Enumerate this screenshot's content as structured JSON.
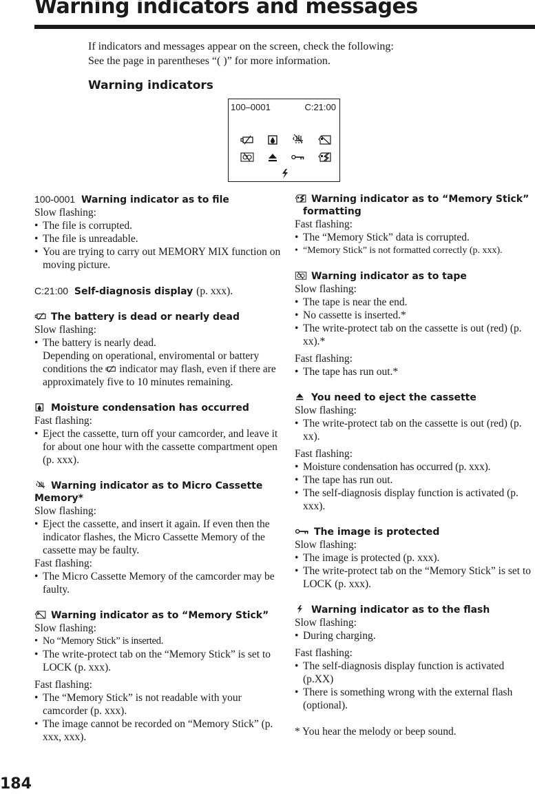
{
  "page": {
    "title": "Warning indicators and messages",
    "intro_line1": "If indicators and messages appear on the screen, check the following:",
    "intro_line2": "See the page in parentheses “(    )” for more information.",
    "subheading": "Warning indicators",
    "page_number": "184"
  },
  "screen": {
    "file_number": "100–0001",
    "self_diagnosis_code": "C:21:00",
    "icons": [
      "battery-dead-icon",
      "moisture-icon",
      "cassette-memory-icon",
      "memory-stick-icon",
      "tape-warning-icon",
      "eject-icon",
      "protect-key-icon",
      "memory-stick-format-icon",
      "flash-icon"
    ]
  },
  "left": {
    "file": {
      "code": "100-0001",
      "heading": "Warning indicator as to file",
      "label1": "Slow flashing:",
      "items1": [
        "The file is corrupted.",
        "The file is unreadable.",
        "You are trying to carry out MEMORY MIX function on moving picture."
      ]
    },
    "diag": {
      "code": "C:21:00",
      "heading": "Self-diagnosis display",
      "ref": "(p. xxx)."
    },
    "battery": {
      "heading": "The battery is dead or nearly dead",
      "label1": "Slow flashing:",
      "item1": "The battery is nearly dead.",
      "cont1": "Depending on operational, enviromental or battery conditions the",
      "cont2": "indicator may flash, even if there are approximately five to 10 minutes remaining."
    },
    "moisture": {
      "heading": "Moisture condensation has occurred",
      "label1": "Fast flashing:",
      "items1": [
        "Eject the cassette, turn off your camcorder, and leave it for about one hour with the cassette compartment open (p. xxx)."
      ]
    },
    "cassette_memory": {
      "heading": "Warning indicator as to Micro Cassette Memory*",
      "label1": "Slow flashing:",
      "items1": [
        "Eject the cassette, and insert it again. If even then the indicator flashes, the Micro Cassette Memory of the cassette may be faulty."
      ],
      "label2": "Fast flashing:",
      "items2": [
        "The Micro Cassette Memory of the camcorder may be faulty."
      ]
    },
    "memory_stick": {
      "heading": "Warning indicator as to “Memory Stick”",
      "label1": "Slow flashing:",
      "items1": [
        "No “Memory Stick” is inserted.",
        "The write-protect tab on the “Memory Stick” is set to LOCK (p. xxx)."
      ],
      "label2": "Fast flashing:",
      "items2": [
        "The “Memory Stick” is not readable with your camcorder (p. xxx).",
        "The image cannot be recorded on “Memory Stick” (p. xxx, xxx)."
      ]
    }
  },
  "right": {
    "ms_format": {
      "heading": "Warning indicator as to “Memory Stick” formatting",
      "label1": "Fast flashing:",
      "items1": [
        "The “Memory Stick” data is corrupted.",
        "“Memory Stick” is not formatted correctly (p. xxx)."
      ]
    },
    "tape": {
      "heading": "Warning indicator as to tape",
      "label1": "Slow flashing:",
      "items1": [
        "The tape is near the end.",
        "No cassette is inserted.*",
        "The write-protect tab on the cassette is out (red) (p. xx).*"
      ],
      "label2": "Fast flashing:",
      "items2": [
        "The tape has run out.*"
      ]
    },
    "eject": {
      "heading": "You need to eject the cassette",
      "label1": "Slow flashing:",
      "items1": [
        "The write-protect tab on the cassette is out (red) (p. xx)."
      ],
      "label2": "Fast flashing:",
      "items2": [
        "Moisture condensation has occurred (p. xxx).",
        "The tape has run out.",
        "The self-diagnosis display function is activated (p. xxx)."
      ]
    },
    "protect": {
      "heading": "The image is protected",
      "label1": "Slow flashing:",
      "items1": [
        "The image is protected (p. xxx).",
        "The write-protect tab on the “Memory Stick” is set to LOCK (p. xxx)."
      ]
    },
    "flash": {
      "heading": "Warning indicator as to the flash",
      "label1": "Slow flashing:",
      "items1": [
        "During charging."
      ],
      "label2": "Fast flashing:",
      "items2": [
        "The self-diagnosis display function is activated (p.XX)",
        "There is something wrong with the external flash (optional)."
      ]
    },
    "footnote": "* You hear the melody or beep sound."
  }
}
